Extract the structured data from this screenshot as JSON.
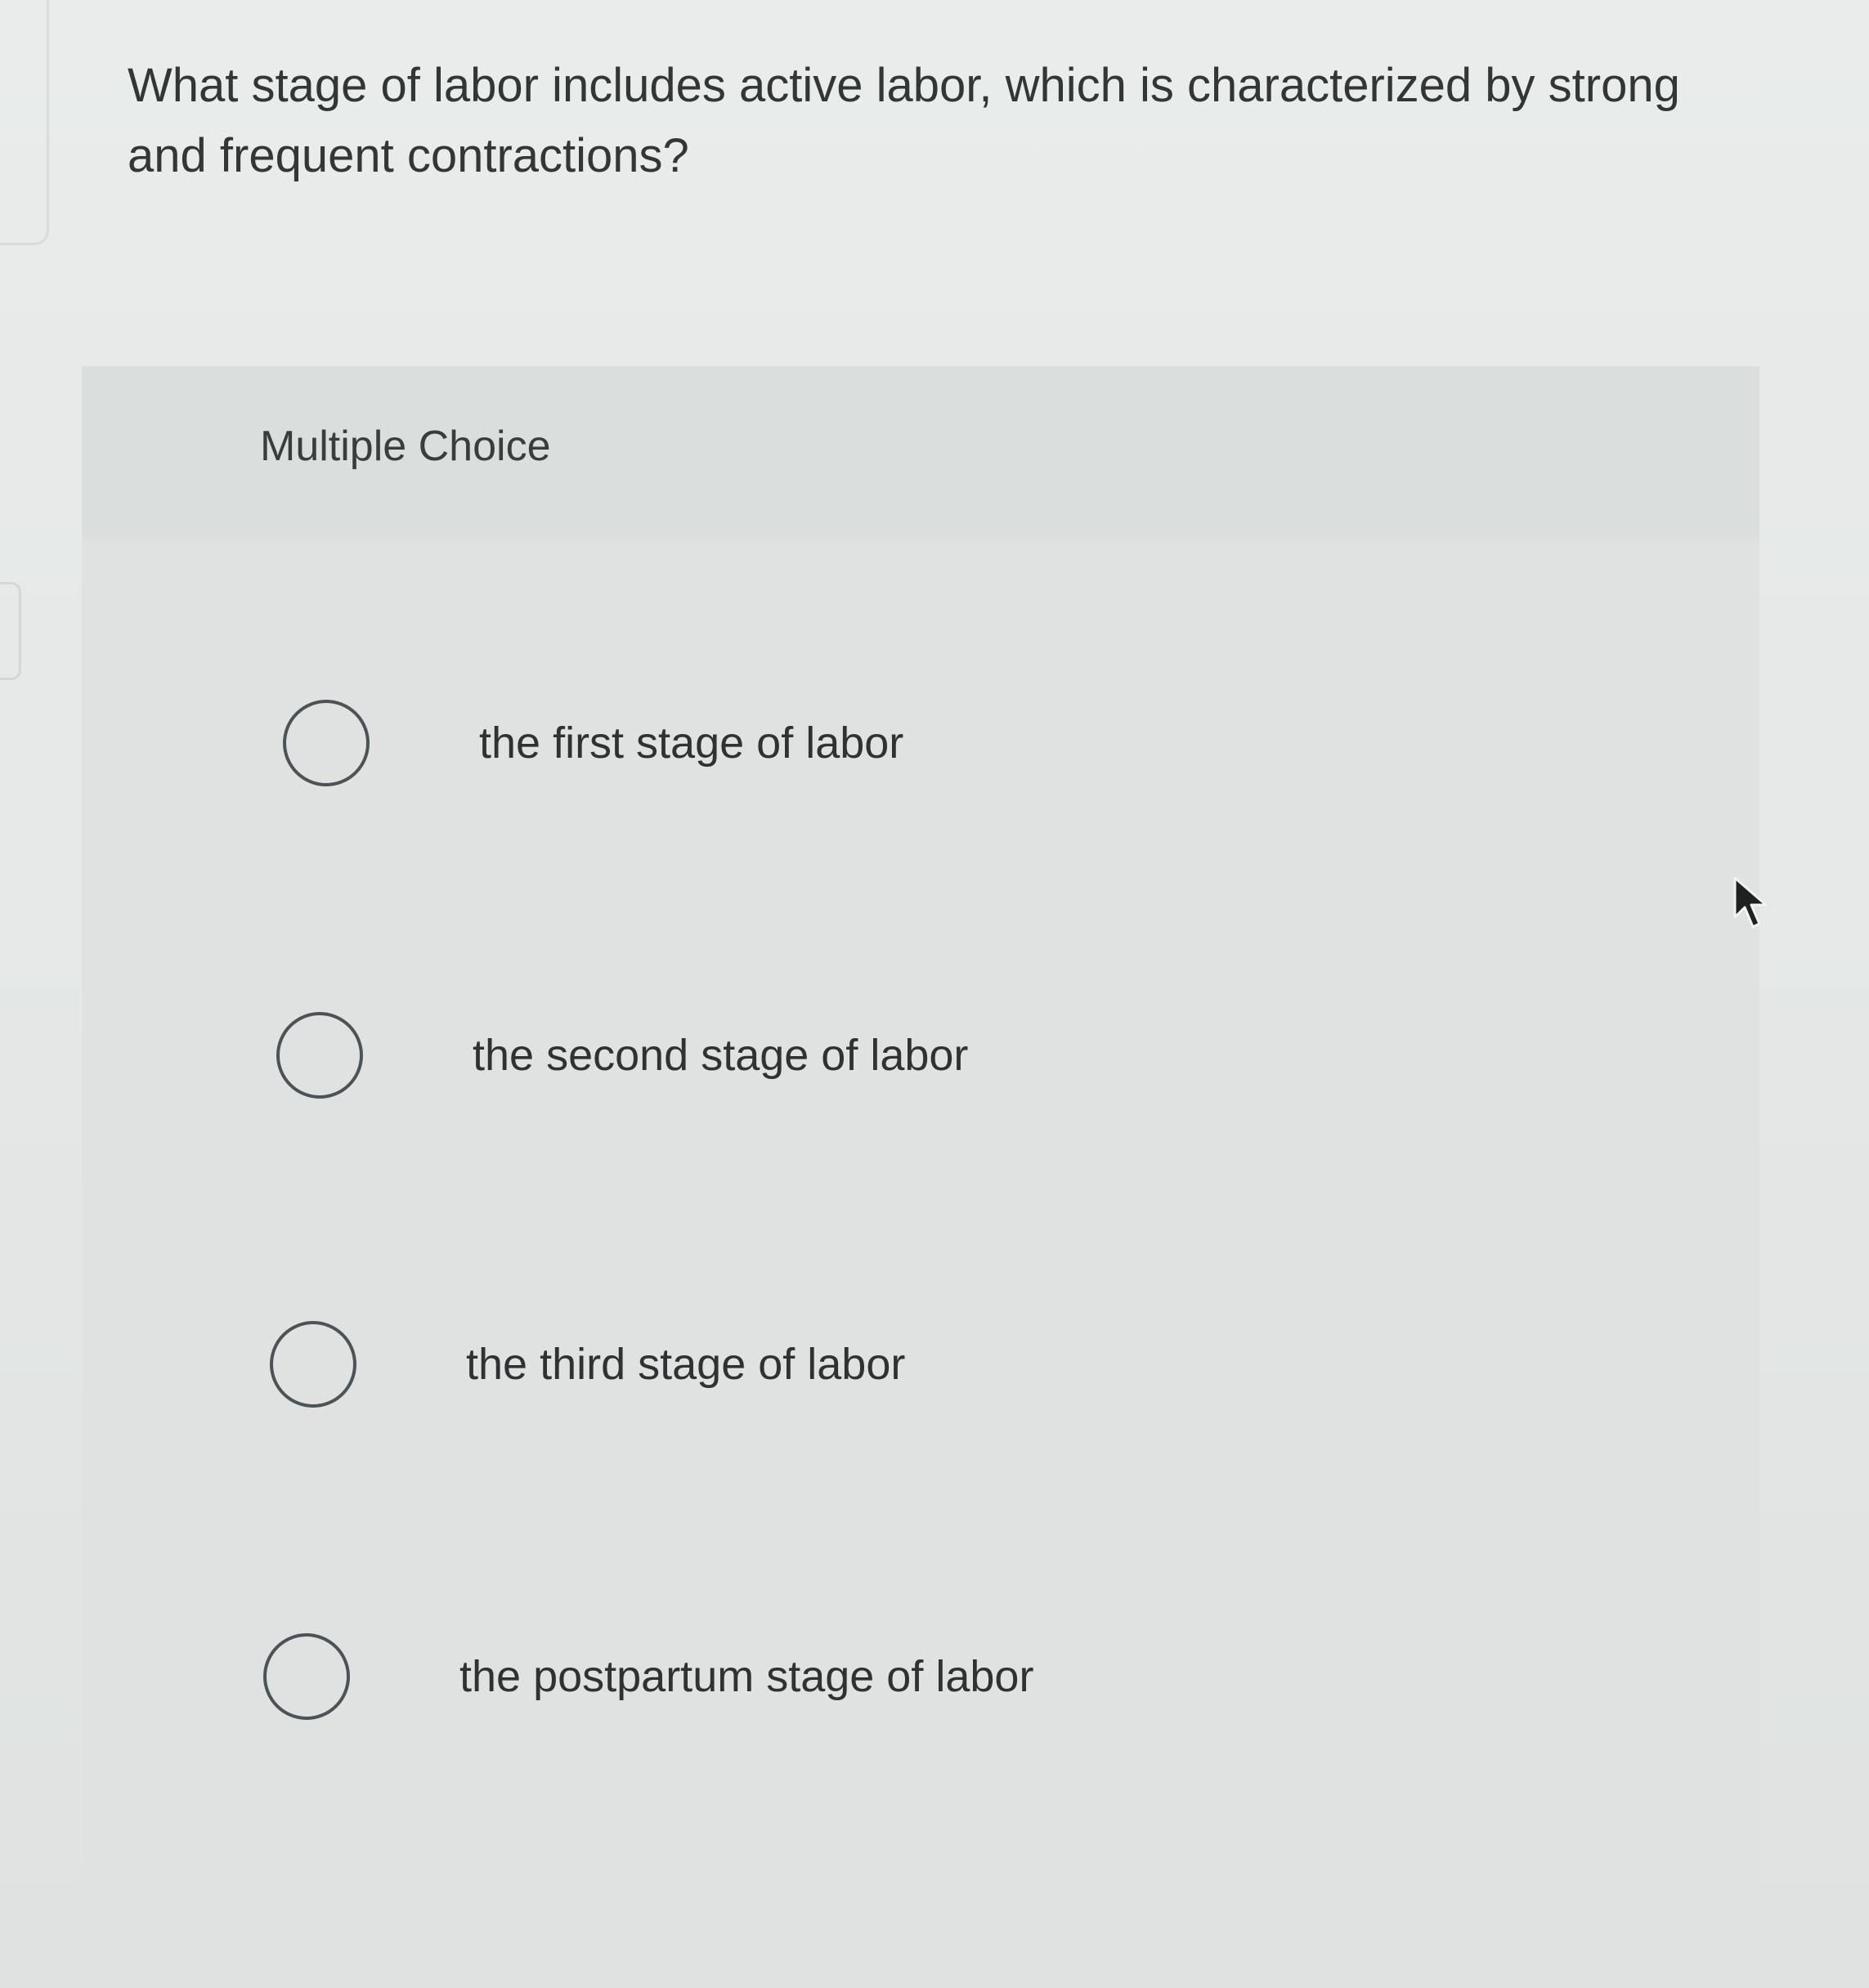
{
  "question": {
    "text": "What stage of labor includes active labor, which is characterized by strong and frequent contractions?"
  },
  "multiple_choice": {
    "label": "Multiple Choice",
    "options": [
      {
        "label": "the first stage of labor",
        "selected": false
      },
      {
        "label": "the second stage of labor",
        "selected": false
      },
      {
        "label": "the third stage of labor",
        "selected": false
      },
      {
        "label": "the postpartum stage of labor",
        "selected": false
      }
    ]
  },
  "colors": {
    "background": "#e6e9e8",
    "card": "#dfe2e1",
    "text": "#2e3233",
    "radio_border": "#4c5356"
  },
  "icons": {
    "cursor": "mouse-pointer-icon"
  }
}
